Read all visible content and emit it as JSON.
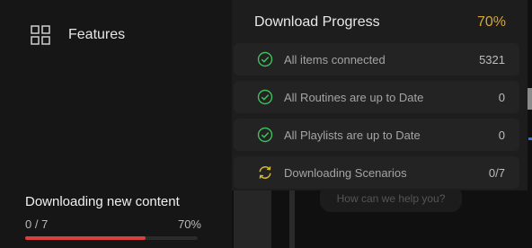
{
  "sidebar": {
    "nav_item": {
      "label": "Features",
      "icon": "grid-icon"
    }
  },
  "download": {
    "title": "Downloading new content",
    "count": "0 / 7",
    "percent_label": "70%",
    "progress": 0.7,
    "bar_color": "#dc3d3d"
  },
  "panel": {
    "title": "Download Progress",
    "percent": "70%",
    "accent": "#d6a73a",
    "rows": [
      {
        "label": "All items connected",
        "value": "5321",
        "status": "done",
        "icon": "check-circle-icon"
      },
      {
        "label": "All Routines are up to Date",
        "value": "0",
        "status": "done",
        "icon": "check-circle-icon"
      },
      {
        "label": "All Playlists are up to Date",
        "value": "0",
        "status": "done",
        "icon": "check-circle-icon"
      },
      {
        "label": "Downloading Scenarios",
        "value": "0/7",
        "status": "syncing",
        "icon": "sync-icon"
      }
    ],
    "done_color": "#3fbf5a",
    "syncing_color": "#d6b62a"
  },
  "background": {
    "help_text": "How can we help you?"
  }
}
